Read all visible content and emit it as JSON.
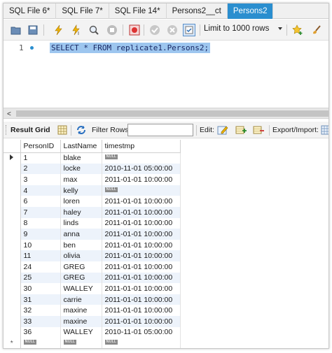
{
  "tabs": [
    {
      "label": "SQL File 6*",
      "active": false
    },
    {
      "label": "SQL File 7*",
      "active": false
    },
    {
      "label": "SQL File 14*",
      "active": false
    },
    {
      "label": "Persons2__ct",
      "active": false
    },
    {
      "label": "Persons2",
      "active": true
    }
  ],
  "toolbar": {
    "limit_label": "Limit to 1000 rows"
  },
  "editor": {
    "line_number": "1",
    "query": "SELECT * FROM replicate1.Persons2;"
  },
  "result_toolbar": {
    "result_grid_label": "Result Grid",
    "filter_label": "Filter Rows:",
    "filter_value": "",
    "edit_label": "Edit:",
    "export_label": "Export/Import:"
  },
  "grid": {
    "columns": [
      "PersonID",
      "LastName",
      "timestmp"
    ],
    "null_label": "NULL",
    "rows": [
      {
        "id": "1",
        "name": "blake",
        "ts": null
      },
      {
        "id": "2",
        "name": "locke",
        "ts": "2010-11-01 05:00:00"
      },
      {
        "id": "3",
        "name": "max",
        "ts": "2011-01-01 10:00:00"
      },
      {
        "id": "4",
        "name": "kelly",
        "ts": null
      },
      {
        "id": "6",
        "name": "loren",
        "ts": "2011-01-01 10:00:00"
      },
      {
        "id": "7",
        "name": "haley",
        "ts": "2011-01-01 10:00:00"
      },
      {
        "id": "8",
        "name": "linds",
        "ts": "2011-01-01 10:00:00"
      },
      {
        "id": "9",
        "name": "anna",
        "ts": "2011-01-01 10:00:00"
      },
      {
        "id": "10",
        "name": "ben",
        "ts": "2011-01-01 10:00:00"
      },
      {
        "id": "11",
        "name": "olivia",
        "ts": "2011-01-01 10:00:00"
      },
      {
        "id": "24",
        "name": "GREG",
        "ts": "2011-01-01 10:00:00"
      },
      {
        "id": "25",
        "name": "GREG",
        "ts": "2011-01-01 10:00:00"
      },
      {
        "id": "30",
        "name": "WALLEY",
        "ts": "2011-01-01 10:00:00"
      },
      {
        "id": "31",
        "name": "carrie",
        "ts": "2011-01-01 10:00:00"
      },
      {
        "id": "32",
        "name": "maxine",
        "ts": "2011-01-01 10:00:00"
      },
      {
        "id": "33",
        "name": "maxine",
        "ts": "2011-01-01 10:00:00"
      },
      {
        "id": "36",
        "name": "WALLEY",
        "ts": "2010-11-01 05:00:00"
      }
    ]
  },
  "colors": {
    "active_tab": "#2a8ecf",
    "selection": "#9dc6ef",
    "alt_row": "#edf3fb"
  }
}
